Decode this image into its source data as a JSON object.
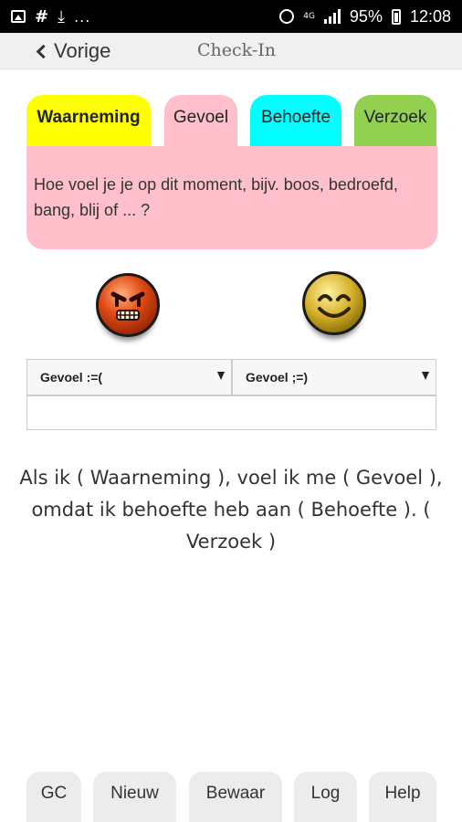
{
  "status_bar": {
    "dots": "...",
    "network": "4G",
    "battery": "95%",
    "time": "12:08"
  },
  "nav": {
    "back_label": "Vorige",
    "title": "Check-In"
  },
  "tabs": [
    {
      "label": "Waarneming",
      "color": "#ffff00"
    },
    {
      "label": "Gevoel",
      "color": "#ffc0cb"
    },
    {
      "label": "Behoefte",
      "color": "#00ffff"
    },
    {
      "label": "Verzoek",
      "color": "#92d050"
    }
  ],
  "panel": {
    "text": "Hoe voel je je op dit moment, bijv. boos, bedroefd, bang, blij of ... ?"
  },
  "emoji": {
    "negative": "angry-face-icon",
    "positive": "smiling-face-icon"
  },
  "selects": [
    {
      "value": "Gevoel :=("
    },
    {
      "value": "Gevoel ;=)"
    }
  ],
  "sentence": "Als ik ( Waarneming ), voel ik me ( Gevoel ), omdat ik behoefte heb aan ( Behoefte ). ( Verzoek )",
  "bottom_buttons": [
    "GC",
    "Nieuw",
    "Bewaar",
    "Log",
    "Help"
  ]
}
